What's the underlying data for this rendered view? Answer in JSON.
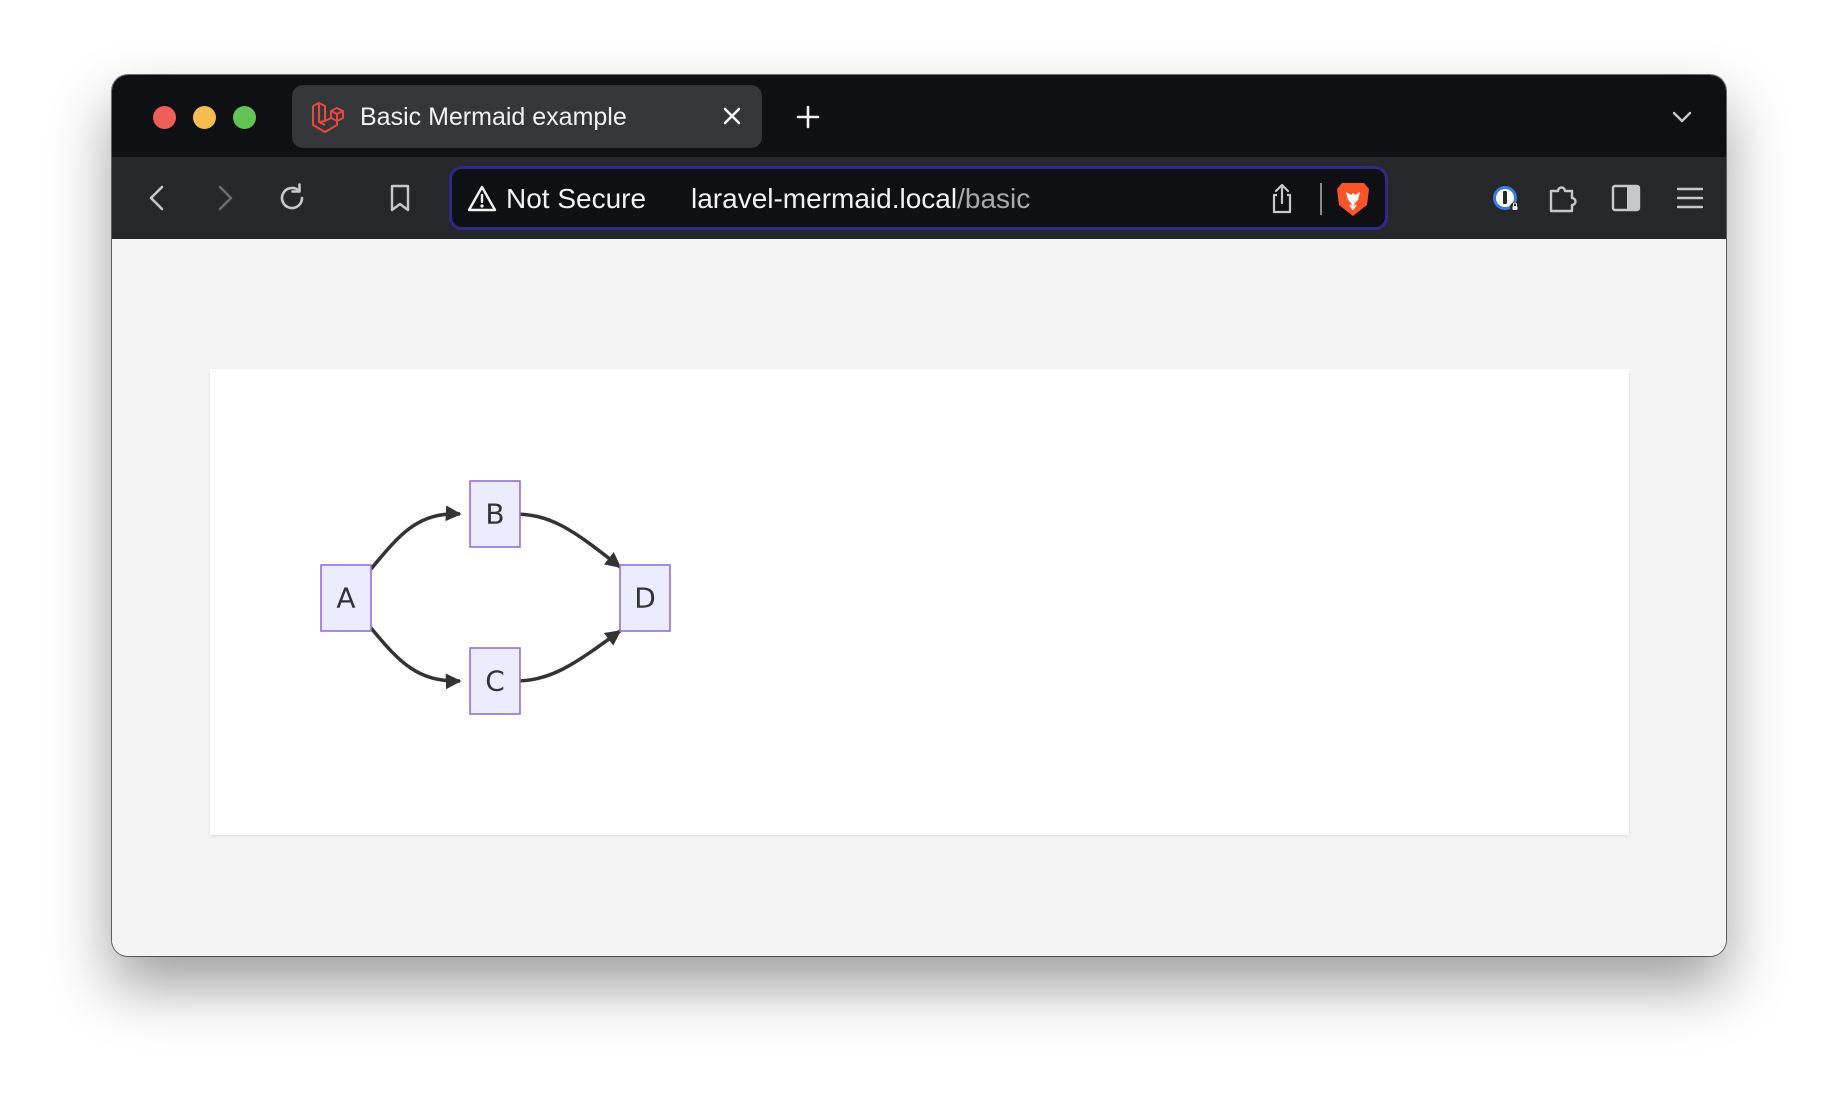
{
  "browser": {
    "tab": {
      "title": "Basic Mermaid example",
      "favicon": "laravel-logo-icon",
      "close_icon": "close-icon"
    },
    "new_tab_icon": "plus-icon",
    "tab_dropdown_icon": "chevron-down-icon",
    "toolbar": {
      "back_icon": "chevron-left-icon",
      "forward_icon": "chevron-right-icon",
      "reload_icon": "reload-icon",
      "bookmark_icon": "bookmark-icon",
      "security_label": "Not Secure",
      "url_host": "laravel-mermaid.local",
      "url_path": "/basic",
      "share_icon": "share-icon",
      "brave_shield_icon": "brave-lion-icon",
      "password_manager_icon": "password-manager-icon",
      "extensions_icon": "puzzle-piece-icon",
      "sidebar_icon": "sidebar-icon",
      "menu_icon": "hamburger-menu-icon"
    },
    "colors": {
      "tabstrip": "#0f1014",
      "toolbar": "#26272b",
      "omnibox_border": "#2f2a86",
      "page_background": "#f4f4f4"
    }
  },
  "diagram": {
    "type": "flowchart LR",
    "nodes": [
      {
        "id": "A",
        "label": "A"
      },
      {
        "id": "B",
        "label": "B"
      },
      {
        "id": "C",
        "label": "C"
      },
      {
        "id": "D",
        "label": "D"
      }
    ],
    "edges": [
      {
        "from": "A",
        "to": "B"
      },
      {
        "from": "A",
        "to": "C"
      },
      {
        "from": "B",
        "to": "D"
      },
      {
        "from": "C",
        "to": "D"
      }
    ],
    "colors": {
      "node_fill": "#ececff",
      "node_stroke": "#9370db",
      "edge": "#333333"
    }
  }
}
